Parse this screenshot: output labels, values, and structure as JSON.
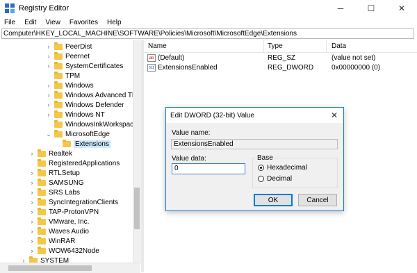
{
  "window": {
    "title": "Registry Editor",
    "minimize": "─",
    "maximize": "☐",
    "close": "✕"
  },
  "menu": [
    "File",
    "Edit",
    "View",
    "Favorites",
    "Help"
  ],
  "address": "Computer\\HKEY_LOCAL_MACHINE\\SOFTWARE\\Policies\\Microsoft\\MicrosoftEdge\\Extensions",
  "tree": [
    {
      "label": "PeerDist",
      "chev": "›"
    },
    {
      "label": "Peernet",
      "chev": "›"
    },
    {
      "label": "SystemCertificates",
      "chev": "›"
    },
    {
      "label": "TPM",
      "chev": ""
    },
    {
      "label": "Windows",
      "chev": "›"
    },
    {
      "label": "Windows Advanced Threat Protection",
      "chev": "›"
    },
    {
      "label": "Windows Defender",
      "chev": "›"
    },
    {
      "label": "Windows NT",
      "chev": "›"
    },
    {
      "label": "WindowsInkWorkspace",
      "chev": ""
    },
    {
      "label": "MicrosoftEdge",
      "chev": "⌄"
    },
    {
      "label": "Extensions",
      "chev": ""
    },
    {
      "label": "Realtek",
      "chev": "›"
    },
    {
      "label": "RegisteredApplications",
      "chev": ""
    },
    {
      "label": "RTLSetup",
      "chev": "›"
    },
    {
      "label": "SAMSUNG",
      "chev": "›"
    },
    {
      "label": "SRS Labs",
      "chev": "›"
    },
    {
      "label": "SyncIntegrationClients",
      "chev": "›"
    },
    {
      "label": "TAP-ProtonVPN",
      "chev": "›"
    },
    {
      "label": "VMware, Inc.",
      "chev": "›"
    },
    {
      "label": "Waves Audio",
      "chev": "›"
    },
    {
      "label": "WinRAR",
      "chev": "›"
    },
    {
      "label": "WOW6432Node",
      "chev": "›"
    },
    {
      "label": "SYSTEM",
      "chev": "›"
    }
  ],
  "list": {
    "columns": [
      "Name",
      "Type",
      "Data"
    ],
    "rows": [
      {
        "icon": "ab",
        "name": "(Default)",
        "type": "REG_SZ",
        "data": "(value not set)"
      },
      {
        "icon": "011",
        "name": "ExtensionsEnabled",
        "type": "REG_DWORD",
        "data": "0x00000000 (0)"
      }
    ]
  },
  "dialog": {
    "title": "Edit DWORD (32-bit) Value",
    "close": "✕",
    "value_name_label": "Value name:",
    "value_name": "ExtensionsEnabled",
    "value_data_label": "Value data:",
    "value_data": "0",
    "base_label": "Base",
    "hex_label": "Hexadecimal",
    "dec_label": "Decimal",
    "ok": "OK",
    "cancel": "Cancel"
  }
}
